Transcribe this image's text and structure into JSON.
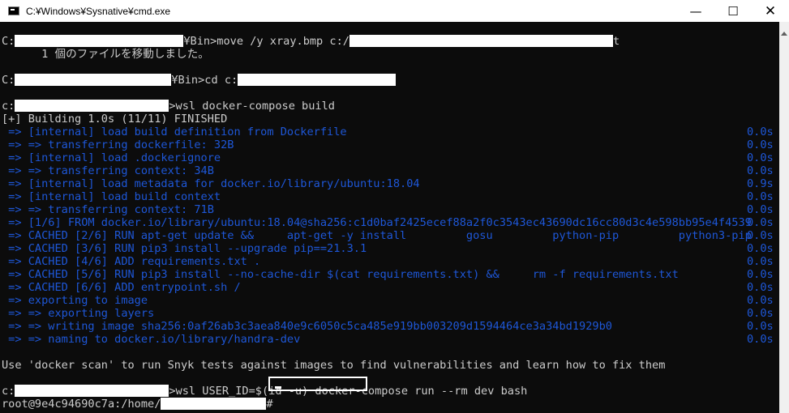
{
  "window": {
    "title": "C:¥Windows¥Sysnative¥cmd.exe",
    "minimize_glyph": "—",
    "maximize_glyph": "☐",
    "close_glyph": "✕"
  },
  "console": {
    "l1a": "C:",
    "l1b": "¥Bin>move /y xray.bmp c:/",
    "l1c": "t",
    "l2": "      1 個のファイルを移動しました。",
    "l3a": "C:",
    "l3b": "¥Bin>cd c:",
    "l4a": "c:",
    "l4b": ">wsl docker-compose build",
    "l5": "[+] Building 1.0s (11/11) FINISHED",
    "build_steps": [
      {
        "text": " => [internal] load build definition from Dockerfile",
        "time": "0.0s"
      },
      {
        "text": " => => transferring dockerfile: 32B",
        "time": "0.0s"
      },
      {
        "text": " => [internal] load .dockerignore",
        "time": "0.0s"
      },
      {
        "text": " => => transferring context: 34B",
        "time": "0.0s"
      },
      {
        "text": " => [internal] load metadata for docker.io/library/ubuntu:18.04",
        "time": "0.9s"
      },
      {
        "text": " => [internal] load build context",
        "time": "0.0s"
      },
      {
        "text": " => => transferring context: 71B",
        "time": "0.0s"
      },
      {
        "text": " => [1/6] FROM docker.io/library/ubuntu:18.04@sha256:c1d0baf2425ecef88a2f0c3543ec43690dc16cc80d3c4e598bb95e4f4539",
        "time": "0.0s"
      },
      {
        "text": " => CACHED [2/6] RUN apt-get update &&     apt-get -y install         gosu         python-pip         python3-pip",
        "time": "0.0s"
      },
      {
        "text": " => CACHED [3/6] RUN pip3 install --upgrade pip==21.3.1",
        "time": "0.0s"
      },
      {
        "text": " => CACHED [4/6] ADD requirements.txt .",
        "time": "0.0s"
      },
      {
        "text": " => CACHED [5/6] RUN pip3 install --no-cache-dir $(cat requirements.txt) &&     rm -f requirements.txt",
        "time": "0.0s"
      },
      {
        "text": " => CACHED [6/6] ADD entrypoint.sh /",
        "time": "0.0s"
      },
      {
        "text": " => exporting to image",
        "time": "0.0s"
      },
      {
        "text": " => => exporting layers",
        "time": "0.0s"
      },
      {
        "text": " => => writing image sha256:0af26ab3c3aea840e9c6050c5ca485e919bb003209d1594464ce3a34bd1929b0",
        "time": "0.0s"
      },
      {
        "text": " => => naming to docker.io/library/handra-dev",
        "time": "0.0s"
      }
    ],
    "scan_hint": "Use 'docker scan' to run Snyk tests against images to find vulnerabilities and learn how to fix them",
    "l_run_a": "c:",
    "l_run_b": ">wsl USER_ID=$(id -u) docker-compose run --rm dev bash",
    "prompt_a": "root@9e4c94690c7a:/home/",
    "prompt_b": "#"
  }
}
